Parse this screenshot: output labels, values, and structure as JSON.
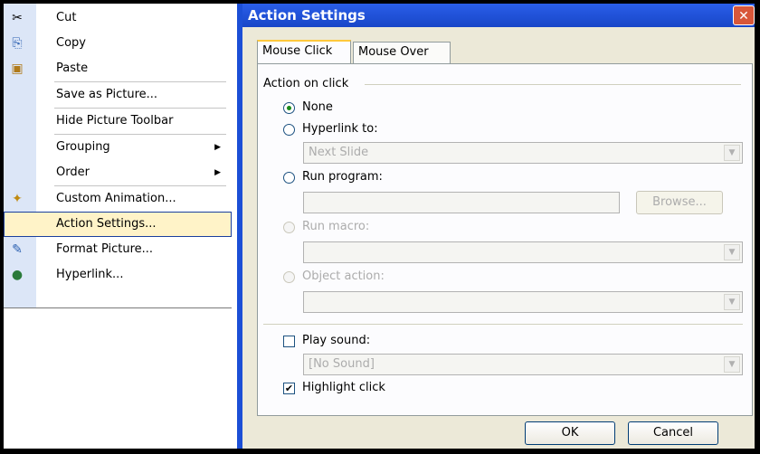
{
  "menu": {
    "items": [
      {
        "label": "Cut",
        "icon": "scissors-icon",
        "glyph": "✂"
      },
      {
        "label": "Copy",
        "icon": "copy-icon",
        "glyph": "⎘"
      },
      {
        "label": "Paste",
        "icon": "paste-icon",
        "glyph": "📋"
      },
      {
        "label": "Save as Picture...",
        "icon": "",
        "glyph": ""
      },
      {
        "label": "Hide Picture Toolbar",
        "icon": "",
        "glyph": ""
      },
      {
        "label": "Grouping",
        "icon": "",
        "glyph": "",
        "submenu": true
      },
      {
        "label": "Order",
        "icon": "",
        "glyph": "",
        "submenu": true
      },
      {
        "label": "Custom Animation...",
        "icon": "custom-animation-icon",
        "glyph": "✦"
      },
      {
        "label": "Action Settings...",
        "icon": "",
        "glyph": "",
        "highlighted": true
      },
      {
        "label": "Format Picture...",
        "icon": "format-picture-icon",
        "glyph": "✎"
      },
      {
        "label": "Hyperlink...",
        "icon": "hyperlink-icon",
        "glyph": "🌐"
      }
    ]
  },
  "dialog": {
    "title": "Action Settings",
    "close_glyph": "✕",
    "tabs": [
      "Mouse Click",
      "Mouse Over"
    ],
    "active_tab": "Mouse Click",
    "group_label": "Action on click",
    "radios": {
      "none": "None",
      "hyperlink": "Hyperlink to:",
      "run_program": "Run program:",
      "run_macro": "Run macro:",
      "object_action": "Object action:"
    },
    "selected_radio": "None",
    "hyperlink_value": "Next Slide",
    "program_value": "",
    "browse_label": "Browse...",
    "macro_value": "",
    "object_value": "",
    "play_sound_label": "Play sound:",
    "play_sound_checked": false,
    "sound_value": "[No Sound]",
    "highlight_label": "Highlight click",
    "highlight_checked": true,
    "ok_label": "OK",
    "cancel_label": "Cancel",
    "dropdown_glyph": "▼",
    "check_glyph": "✔"
  },
  "colors": {
    "titlebar": "#1846c8",
    "menu_highlight": "#fff3c8",
    "dialog_bg": "#ece9d8"
  }
}
